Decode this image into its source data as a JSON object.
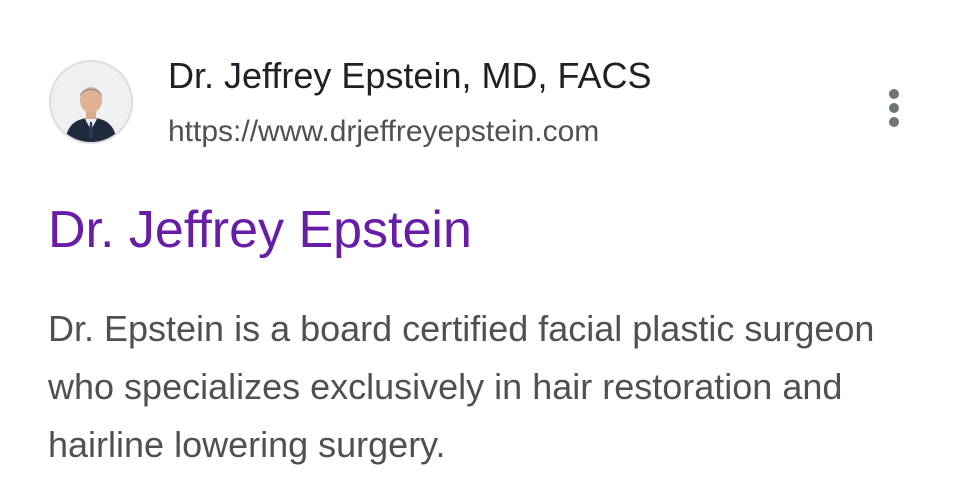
{
  "result": {
    "site_name": "Dr. Jeffrey Epstein, MD, FACS",
    "url": "https://www.drjeffreyepstein.com",
    "title": "Dr. Jeffrey Epstein",
    "snippet": "Dr. Epstein is a board certified facial plastic surgeon who specializes exclusively in hair restoration and hairline lowering surgery."
  },
  "icons": {
    "favicon": "doctor-portrait-favicon",
    "more": "more-vert-icon"
  },
  "colors": {
    "title_visited": "#681da8",
    "site_name": "#202124",
    "body_text": "#4d5156",
    "icon_gray": "#70757a"
  }
}
